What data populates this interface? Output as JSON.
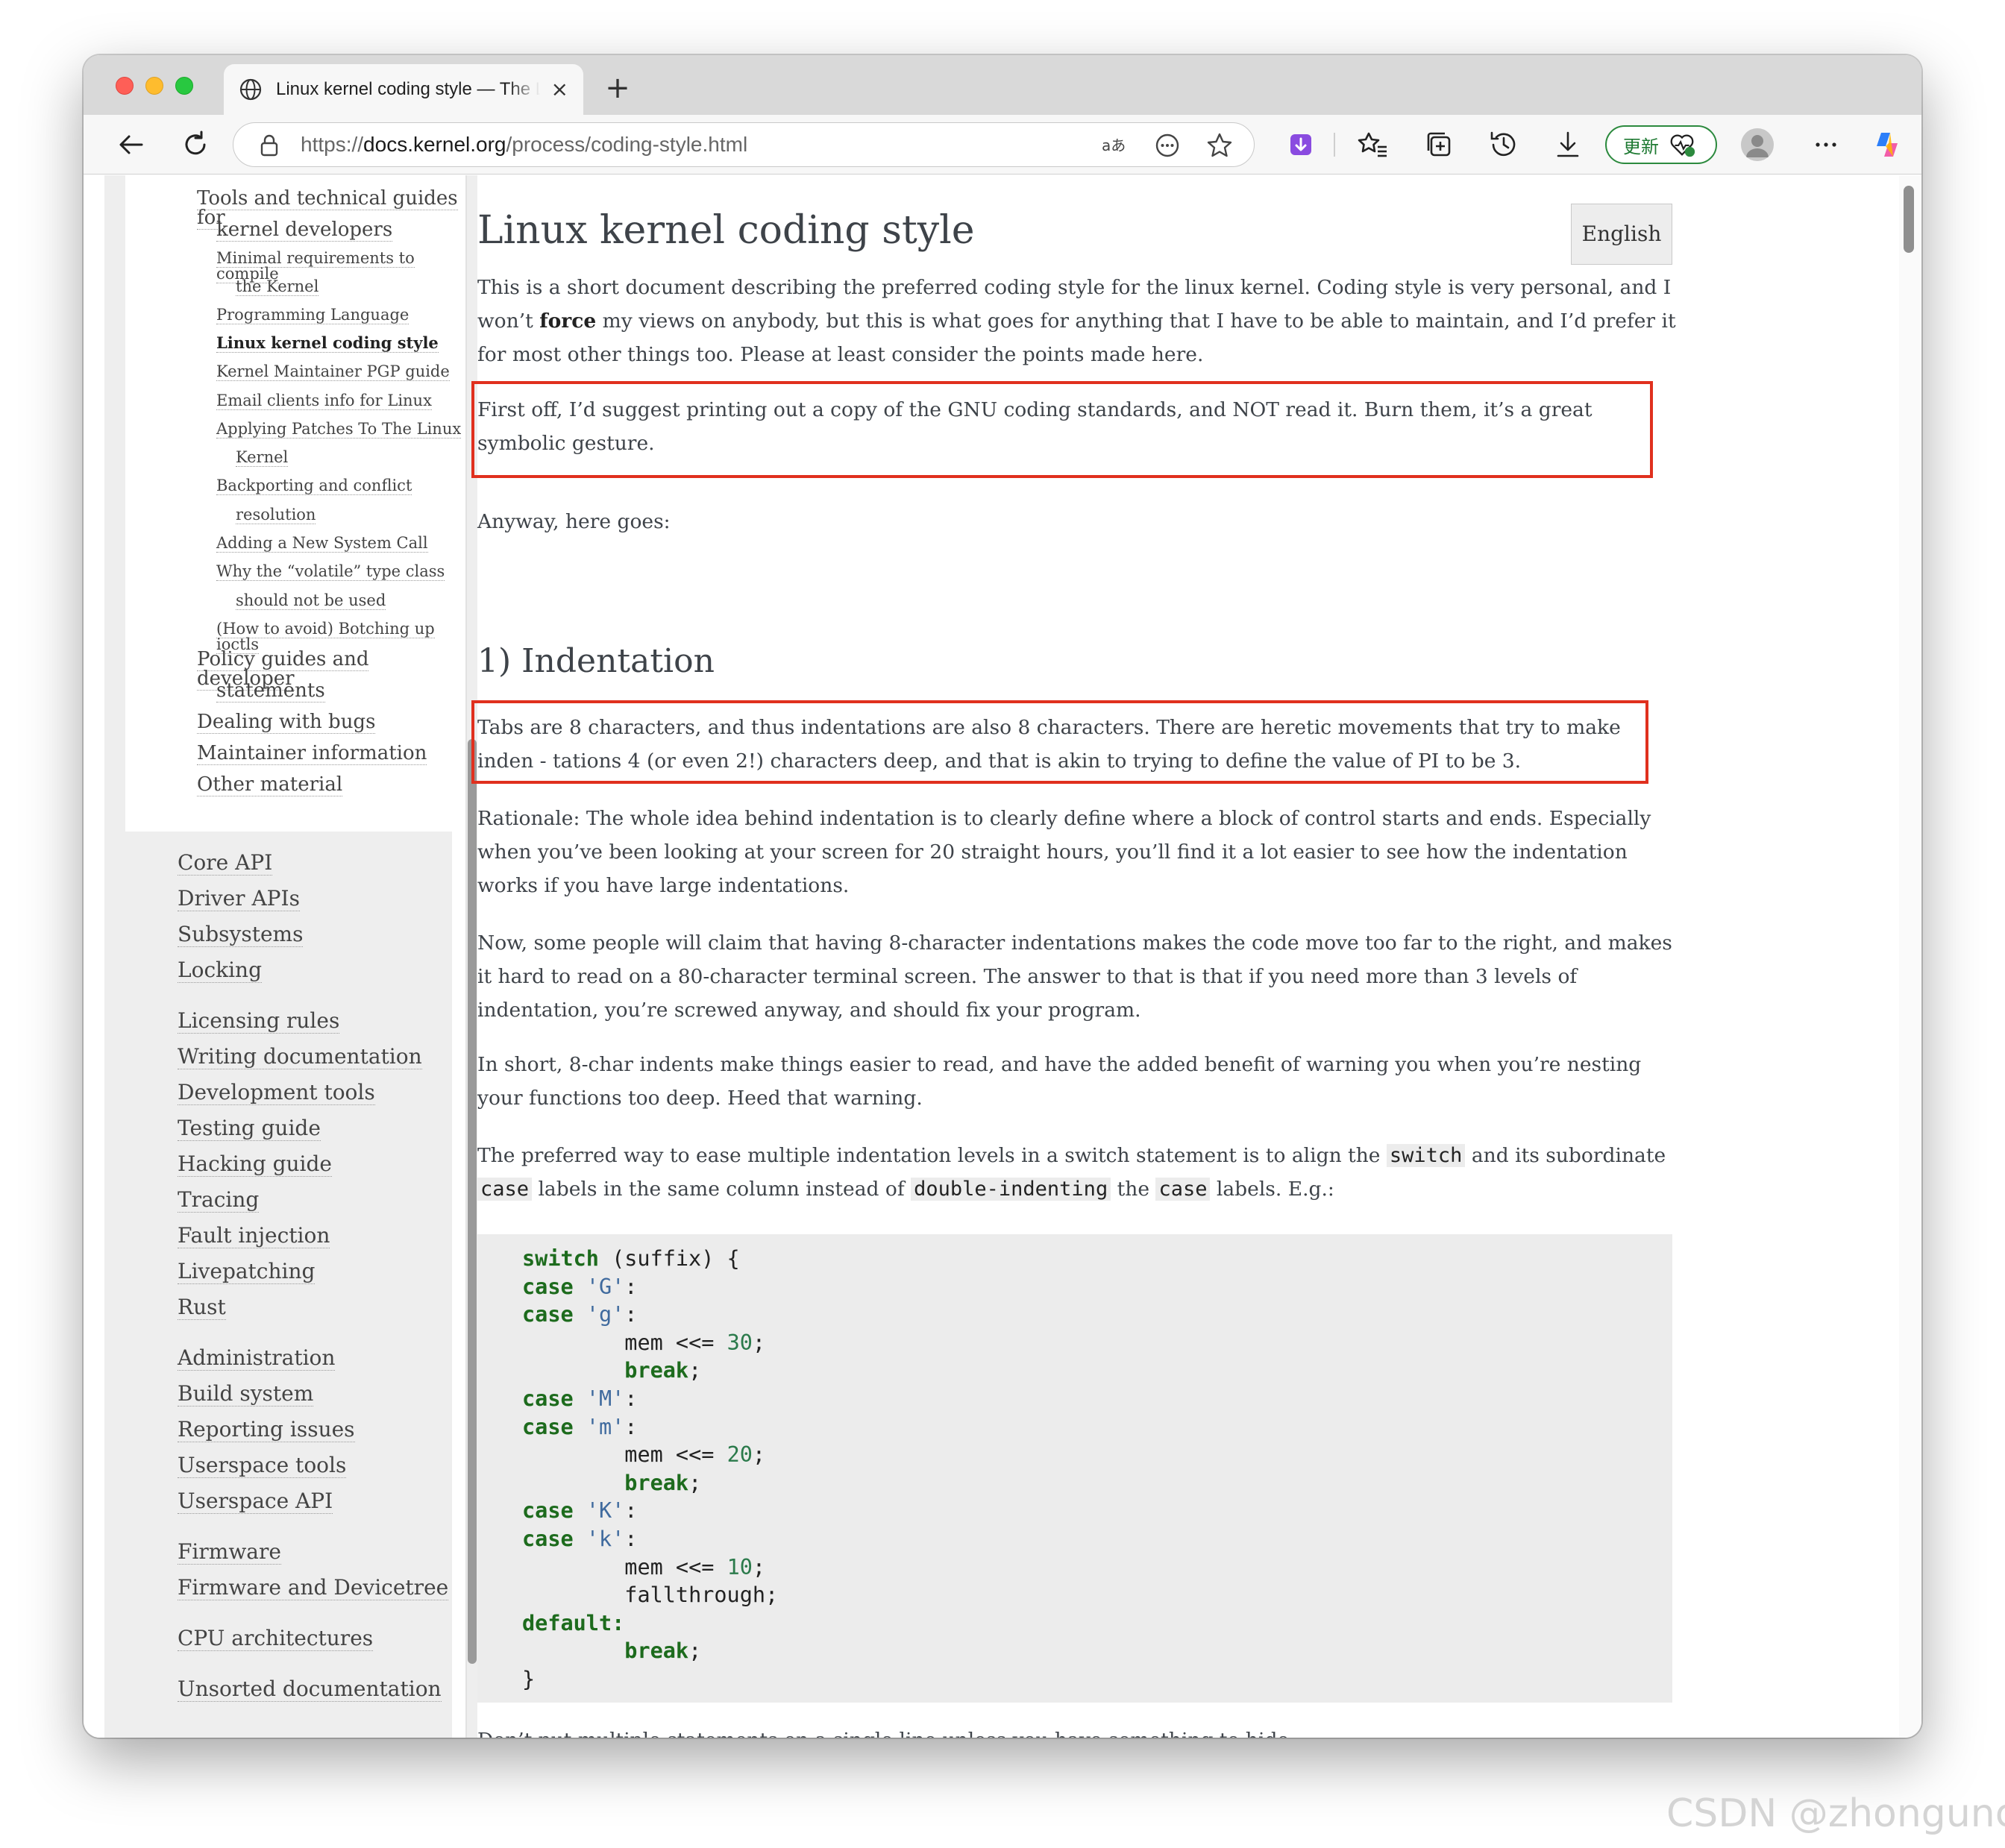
{
  "browser": {
    "tab_title": "Linux kernel coding style — The Linux Kernel documentation",
    "tab_close": "×",
    "new_tab": "+",
    "url_prefix": "https://",
    "url_host": "docs.kernel.org",
    "url_path": "/process/coding-style.html",
    "update_label": "更新"
  },
  "sidebar": {
    "items": [
      {
        "label": "Tools and technical guides for",
        "level": 1
      },
      {
        "label": "kernel developers",
        "level": 1
      },
      {
        "label": "Minimal requirements to compile",
        "level": 2
      },
      {
        "label": "the Kernel",
        "level": 2
      },
      {
        "label": "Programming Language",
        "level": 2
      },
      {
        "label": "Linux kernel coding style",
        "level": 2,
        "current": true
      },
      {
        "label": "Kernel Maintainer PGP guide",
        "level": 2
      },
      {
        "label": "Email clients info for Linux",
        "level": 2
      },
      {
        "label": "Applying Patches To The Linux",
        "level": 2
      },
      {
        "label": "Kernel",
        "level": 2
      },
      {
        "label": "Backporting and conflict",
        "level": 2
      },
      {
        "label": "resolution",
        "level": 2
      },
      {
        "label": "Adding a New System Call",
        "level": 2
      },
      {
        "label": "Why the “volatile” type class",
        "level": 2
      },
      {
        "label": "should not be used",
        "level": 2
      },
      {
        "label": "(How to avoid) Botching up ioctls",
        "level": 2
      },
      {
        "label": "Policy guides and developer",
        "level": 1
      },
      {
        "label": "statements",
        "level": 1
      },
      {
        "label": "Dealing with bugs",
        "level": 1
      },
      {
        "label": "Maintainer information",
        "level": 1
      },
      {
        "label": "Other material",
        "level": 1
      }
    ],
    "top_items": [
      "Core API",
      "Driver APIs",
      "Subsystems",
      "Locking",
      "Licensing rules",
      "Writing documentation",
      "Development tools",
      "Testing guide",
      "Hacking guide",
      "Tracing",
      "Fault injection",
      "Livepatching",
      "Rust",
      "Administration",
      "Build system",
      "Reporting issues",
      "Userspace tools",
      "Userspace API",
      "Firmware",
      "Firmware and Devicetree",
      "CPU architectures",
      "Unsorted documentation"
    ]
  },
  "main": {
    "title": "Linux kernel coding style",
    "language_button": "English",
    "intro_1a": "This is a short document describing the preferred coding style for the linux kernel. Coding style is very personal, and I won’t ",
    "intro_1b": "force",
    "intro_1c": " my views on anybody, but this is what goes for anything that I have to be able to maintain, and I’d prefer it for most other things too. Please at least consider the points made here.",
    "intro_2": "First off, I’d suggest printing out a copy of the GNU coding standards, and NOT read it. Burn them, it’s a great symbolic gesture.",
    "intro_3": "Anyway, here goes:",
    "section_1_title": "1) Indentation",
    "p_tabs": "Tabs are 8 characters, and thus indentations are also 8 characters. There are heretic movements that try to make inden - tations 4 (or even 2!) characters deep, and that is akin to trying to define the value of PI to be 3.",
    "p_rationale": "Rationale: The whole idea behind indentation is to clearly define where a block of control starts and ends. Especially when you’ve been looking at your screen for 20 straight hours, you’ll find it a lot easier to see how the indentation works if you have large indentations.",
    "p_now": "Now, some people will claim that having 8-character indentations makes the code move too far to the right, and makes it hard to read on a 80-character terminal screen. The answer to that is that if you need more than 3 levels of indentation, you’re screwed anyway, and should fix your program.",
    "p_short": "In short, 8-char indents make things easier to read, and have the added benefit of warning you when you’re nesting your functions too deep. Heed that warning.",
    "p_pref_a": "The preferred way to ease multiple indentation levels in a switch statement is to align the ",
    "p_pref_code1": "switch",
    "p_pref_b": " and its subordinate ",
    "p_pref_code2": "case",
    "p_pref_c": " labels in the same column instead of ",
    "p_pref_code3": "double-indenting",
    "p_pref_d": " the ",
    "p_pref_code4": "case",
    "p_pref_e": " labels. E.g.:",
    "code": {
      "l1_kw": "switch",
      "l1_rest": " (suffix) {",
      "case": "case",
      "colon": ":",
      "g_upper": "'G'",
      "g_lower": "'g'",
      "m_upper": "'M'",
      "m_lower": "'m'",
      "k_upper": "'K'",
      "k_lower": "'k'",
      "mem": "mem <<= ",
      "n30": "30",
      "n20": "20",
      "n10": "10",
      "semi": ";",
      "break": "break",
      "fallthrough": "fallthrough;",
      "default": "default",
      "close": "}"
    },
    "p_dont": "Don’t put multiple statements on a single line unless you have something to hide:"
  },
  "watermark": "CSDN @zhonguncle",
  "colors": {
    "highlight_box": "#e0301e",
    "keyword": "#1d6b1d",
    "string": "#3f6a9e",
    "number": "#2b7a4b"
  }
}
